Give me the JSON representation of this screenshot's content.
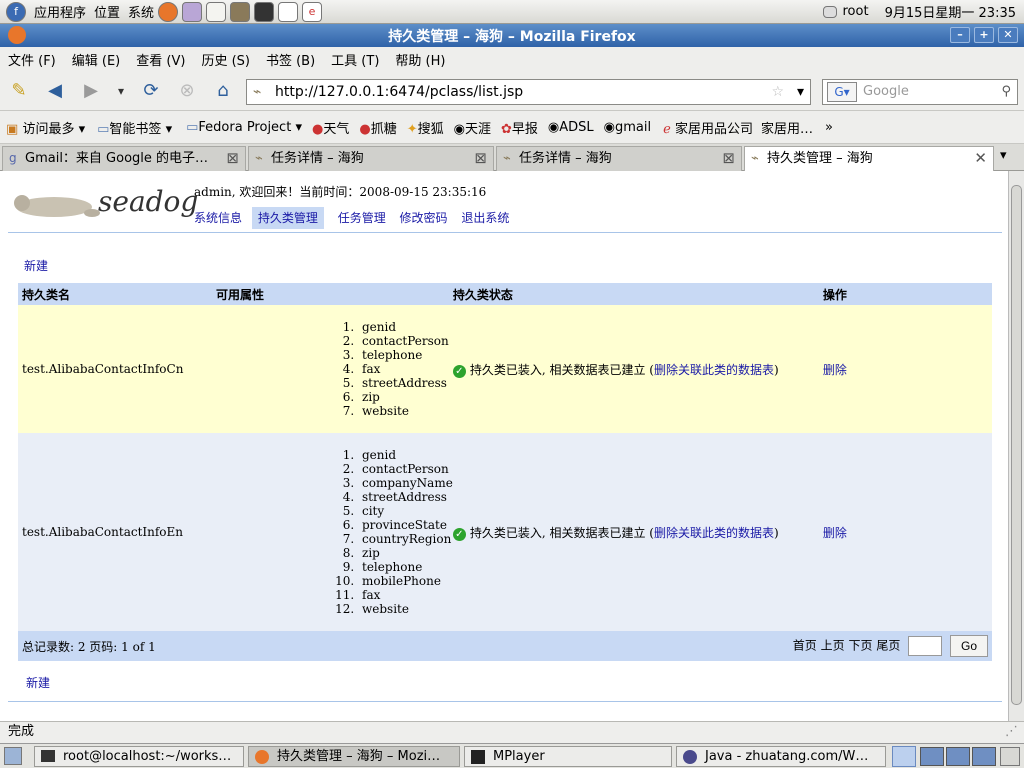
{
  "panel": {
    "menus": [
      "应用程序",
      "位置",
      "系统"
    ],
    "user": "root",
    "clock": "9月15日星期一 23:35"
  },
  "window": {
    "title": "持久类管理 – 海狗 – Mozilla Firefox"
  },
  "menubar": [
    "文件 (F)",
    "编辑 (E)",
    "查看 (V)",
    "历史 (S)",
    "书签 (B)",
    "工具 (T)",
    "帮助 (H)"
  ],
  "nav": {
    "url": "http://127.0.0.1:6474/pclass/list.jsp",
    "search_placeholder": "Google"
  },
  "bookmarks": [
    "访问最多",
    "智能书签",
    "Fedora Project",
    "天气",
    "抓糖",
    "搜狐",
    "天涯",
    "早报",
    "ADSL",
    "gmail",
    "家居用品公司",
    "家居用…"
  ],
  "tabs": [
    "Gmail：来自 Google 的电子…",
    "任务详情 – 海狗",
    "任务详情 – 海狗",
    "持久类管理 – 海狗"
  ],
  "page": {
    "logo_text": "seadog",
    "welcome": "admin, 欢迎回来！当前时间：2008-09-15 23:35:16",
    "nav": [
      "系统信息",
      "持久类管理",
      "任务管理",
      "修改密码",
      "退出系统"
    ],
    "new_link": "新建",
    "columns": [
      "持久类名",
      "可用属性",
      "持久类状态",
      "操作"
    ],
    "rows": [
      {
        "name": "test.AlibabaContactInfoCn",
        "props": [
          "genid",
          "contactPerson",
          "telephone",
          "fax",
          "streetAddress",
          "zip",
          "website"
        ],
        "status": "持久类已装入, 相关数据表已建立",
        "status_link": "删除关联此类的数据表",
        "action": "删除"
      },
      {
        "name": "test.AlibabaContactInfoEn",
        "props": [
          "genid",
          "contactPerson",
          "companyName",
          "streetAddress",
          "city",
          "provinceState",
          "countryRegion",
          "zip",
          "telephone",
          "mobilePhone",
          "fax",
          "website"
        ],
        "status": "持久类已装入, 相关数据表已建立",
        "status_link": "删除关联此类的数据表",
        "action": "删除"
      }
    ],
    "footer_summary": "总记录数: 2 页码: 1 of 1",
    "pager": [
      "首页",
      "上页",
      "下页",
      "尾页"
    ],
    "go_label": "Go",
    "new_link_bottom": "新建"
  },
  "status_text": "完成",
  "taskbar": [
    "root@localhost:~/works…",
    "持久类管理 – 海狗 – Mozi…",
    "MPlayer",
    "Java - zhuatang.com/W…"
  ]
}
